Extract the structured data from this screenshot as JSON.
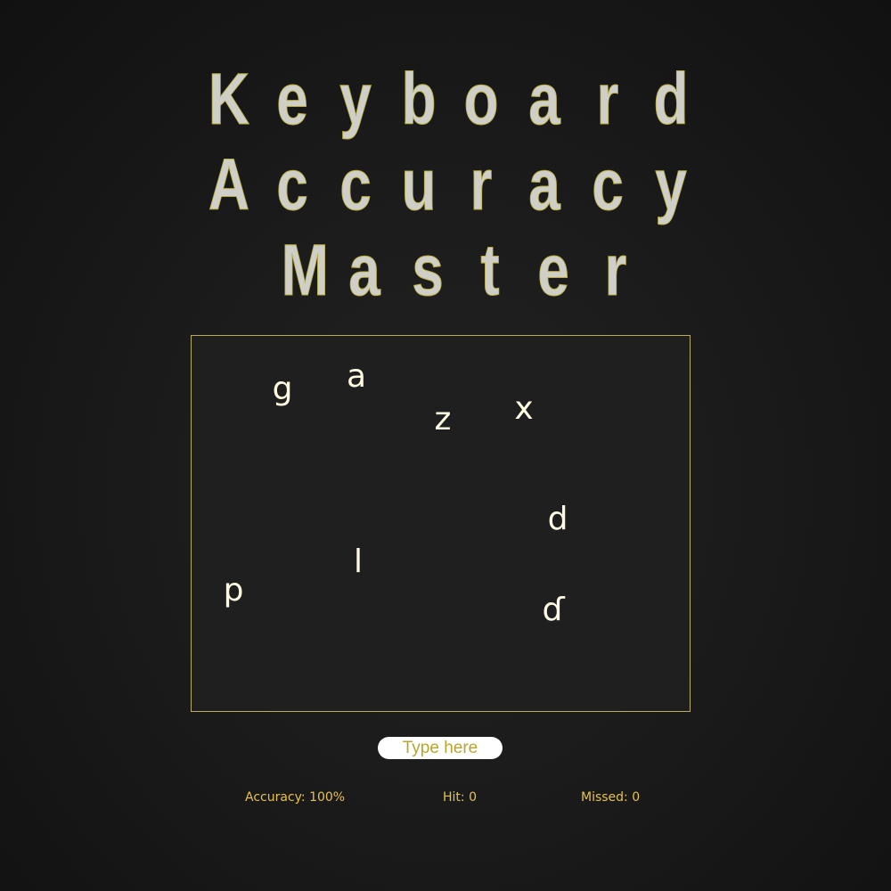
{
  "title": {
    "lines": [
      "Keyboard",
      "Accuracy",
      "Master"
    ]
  },
  "game": {
    "falling_letters": [
      "g",
      "a",
      "z",
      "x",
      "d",
      "l",
      "p",
      "ɗ"
    ]
  },
  "input": {
    "placeholder": "Type here",
    "value": ""
  },
  "stats": {
    "accuracy": "Accuracy: 100%",
    "hit": "Hit: 0",
    "missed": "Missed: 0"
  },
  "colors": {
    "background": "#1b1b1b",
    "game_area": "#1f1f1f",
    "game_border": "#b8ad5c",
    "title_fill": "#cfcfc8",
    "title_stroke": "#b8ad3c",
    "letter": "#fffbe3",
    "stat_text": "#e6c24a",
    "input_text": "#b8a530"
  }
}
